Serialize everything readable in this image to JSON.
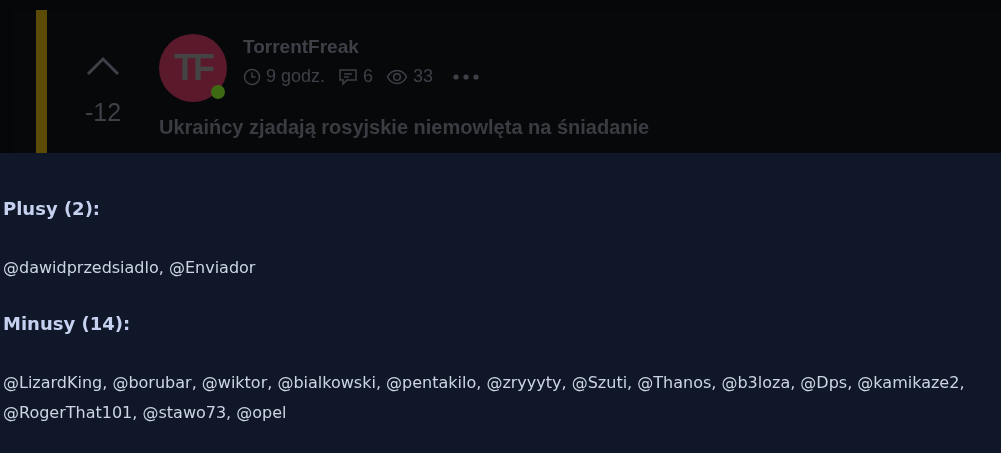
{
  "post": {
    "author": "TorrentFreak",
    "avatar_initials": "TF",
    "online": true,
    "time": "9 godz.",
    "comments": "6",
    "views": "33",
    "score": "-12",
    "title": "Ukraińcy zjadają rosyjskie niemowlęta na śniadanie"
  },
  "votes": [
    {
      "heading": "Plusy (2):",
      "users": "@dawidprzedsiadlo, @Enviador"
    },
    {
      "heading": "Minusy (14):",
      "users": "@LizardKing, @borubar, @wiktor, @bialkowski, @pentakilo, @zryyyty, @Szuti, @Thanos, @b3loza, @Dps, @kamikaze2, @RogerThat101, @stawo73, @opel"
    }
  ]
}
